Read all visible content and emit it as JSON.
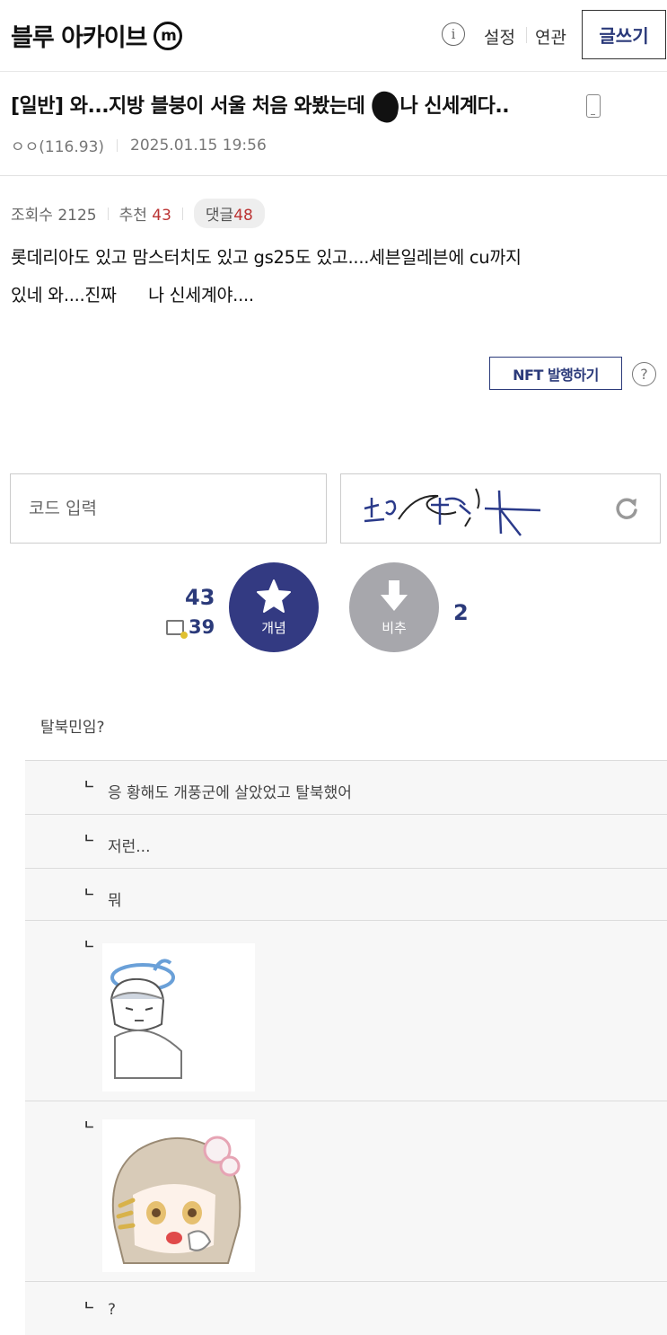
{
  "header": {
    "brand": "블루 아카이브",
    "brand_badge": "m",
    "info_icon": "info-icon",
    "settings": "설정",
    "related": "연관",
    "write": "글쓰기"
  },
  "post": {
    "title_prefix": "[일반] 와...지방 블붕이 서울 처음 와봤는데 ",
    "title_suffix": "나 신세계다..",
    "author": "ㅇㅇ(116.93)",
    "datetime": "2025.01.15 19:56",
    "views_label": "조회수 2125",
    "recommend_label": "추천",
    "recommend_count": "43",
    "comments_label": "댓글",
    "comments_count": "48",
    "body_line1": "롯데리아도 있고 맘스터치도 있고 gs25도 있고....세븐일레븐에 cu까지",
    "body_line2": "있네 와....진짜      나 신세계야...."
  },
  "nft": {
    "label": "NFT 발행하기",
    "help": "?"
  },
  "captcha": {
    "placeholder": "코드 입력"
  },
  "vote": {
    "up_count": "43",
    "sub_count": "39",
    "up_label": "개념",
    "down_label": "비추",
    "down_count": "2"
  },
  "comments": {
    "root": "탈북민임?",
    "reply_mark": "ㄴ",
    "replies": [
      "응 황해도 개풍군에 살았었고 탈북했어",
      "저런...",
      "뭐",
      "",
      "",
      "?"
    ]
  },
  "colors": {
    "accent": "#2b3a7a",
    "upvote": "#333a82",
    "downvote": "#a7a7ac",
    "highlight_red": "#b33333"
  }
}
